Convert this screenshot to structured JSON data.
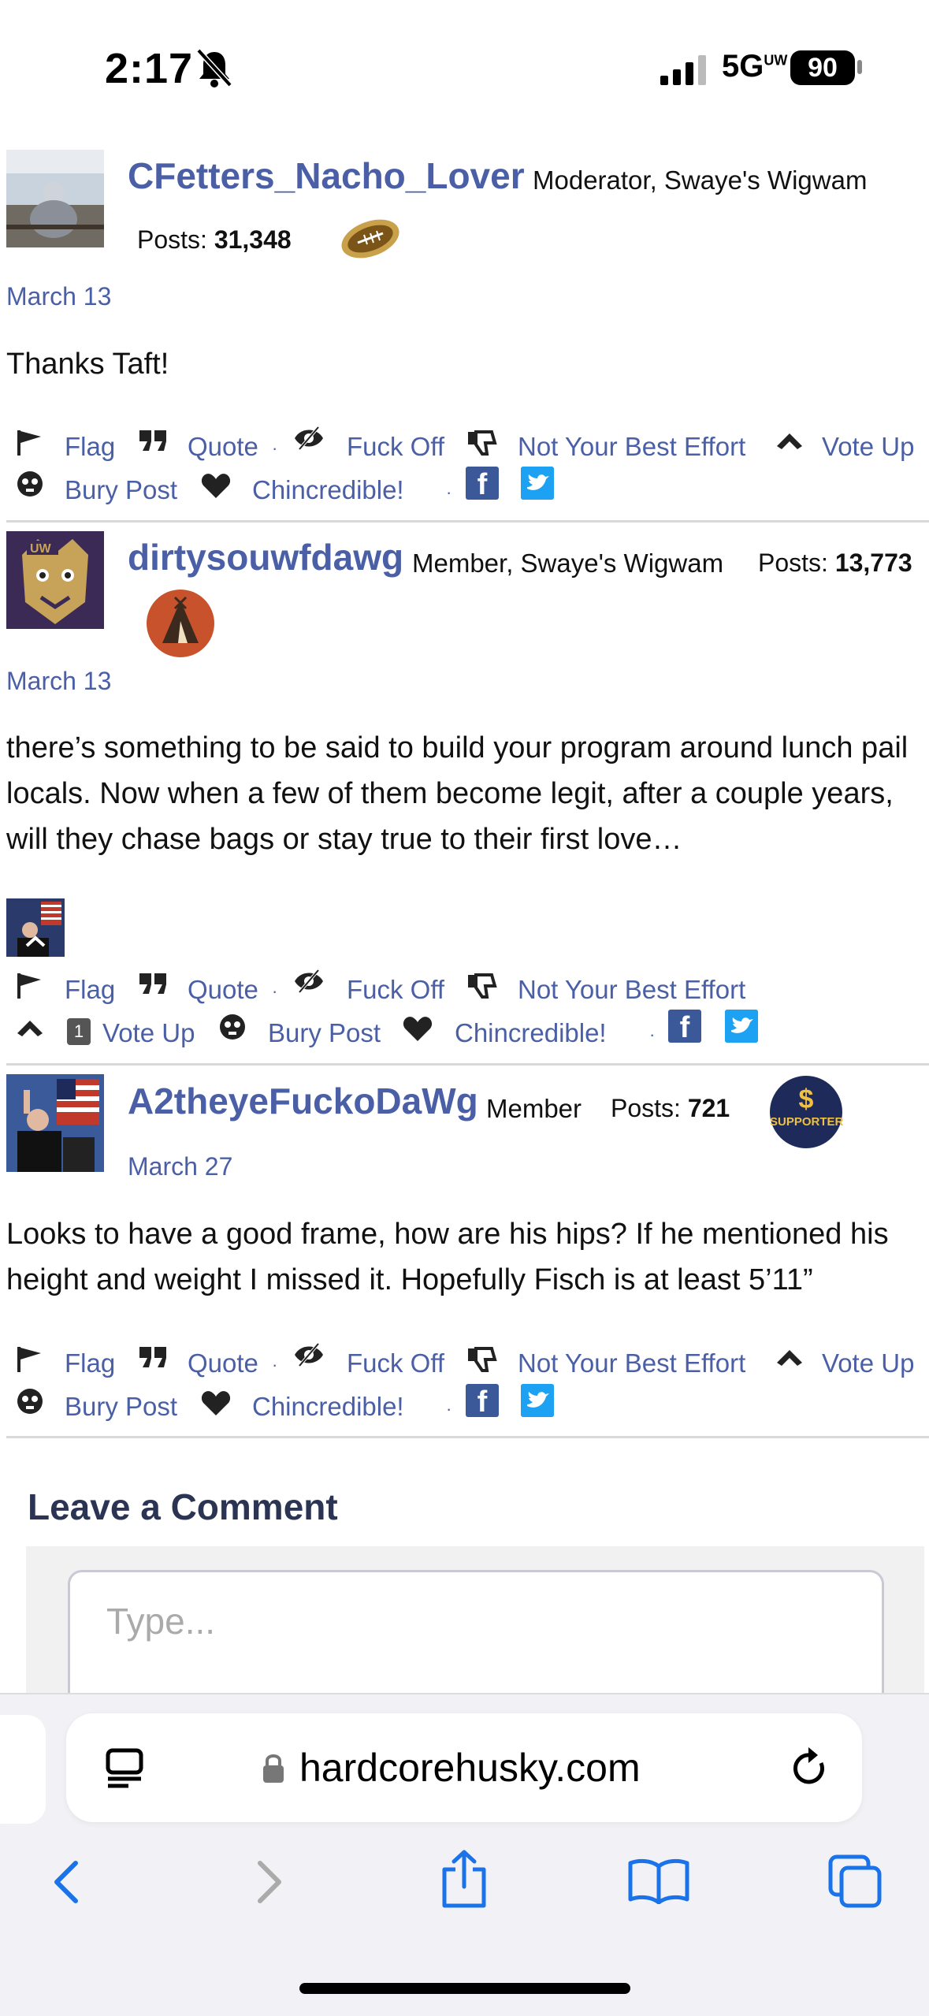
{
  "status": {
    "time": "2:17",
    "network": "5G",
    "network_sup": "UW",
    "battery": "90"
  },
  "posts": [
    {
      "username": "CFetters_Nacho_Lover",
      "role": "Moderator, Swaye's Wigwam",
      "posts_label": "Posts:",
      "posts_count": "31,348",
      "date": "March 13",
      "body": "Thanks Taft!",
      "badge_icon": "football-icon"
    },
    {
      "username": "dirtysouwfdawg",
      "role": "Member, Swaye's Wigwam",
      "posts_label": "Posts:",
      "posts_count": "13,773",
      "date": "March 13",
      "body": "there’s something to be said to build your program around lunch pail locals. Now when a few of them become legit, after a couple years, will they chase bags or stay true to their first love…",
      "vote_count": "1",
      "badge_icon": "teepee-icon"
    },
    {
      "username": "A2theyeFuckoDaWg",
      "role": "Member",
      "posts_label": "Posts:",
      "posts_count": "721",
      "date": "March 27",
      "body": "Looks to have a good frame, how are his hips? If he mentioned his height and weight I missed it. Hopefully Fisch is at least 5’11”",
      "supporter_badge": "SUPPORTER"
    }
  ],
  "actions": {
    "flag": "Flag",
    "quote": "Quote",
    "fuck_off": "Fuck Off",
    "not_best": "Not Your Best Effort",
    "vote_up": "Vote Up",
    "bury": "Bury Post",
    "chincredible": "Chincredible!",
    "separator": "·"
  },
  "comment": {
    "title": "Leave a Comment",
    "placeholder": "Type..."
  },
  "browser": {
    "url": "hardcorehusky.com"
  },
  "colors": {
    "link": "#4a5fa6",
    "heading": "#2b3553",
    "facebook": "#3b5998",
    "twitter": "#1da1f2",
    "supporter": "#1e2a5a"
  }
}
